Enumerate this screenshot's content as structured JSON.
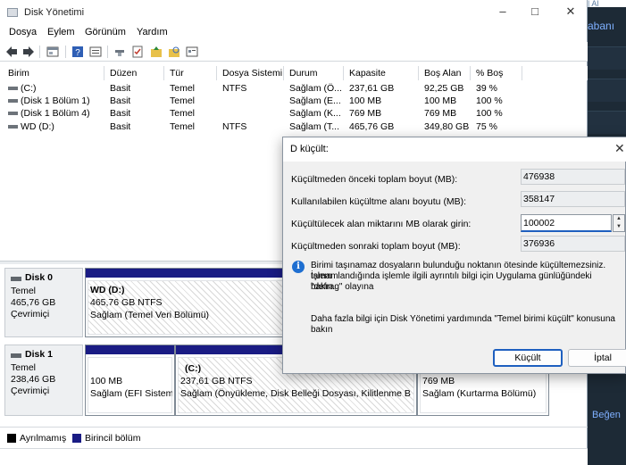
{
  "window": {
    "title": "Disk Yönetimi"
  },
  "background_app": {
    "top_text": "| Al",
    "link1": "abanı",
    "link2": "Beğen"
  },
  "menu": [
    "Dosya",
    "Eylem",
    "Görünüm",
    "Yardım"
  ],
  "volumes": {
    "headers": [
      "Birim",
      "Düzen",
      "Tür",
      "Dosya Sistemi",
      "Durum",
      "Kapasite",
      "Boş Alan",
      "% Boş"
    ],
    "rows": [
      [
        "(C:)",
        "Basit",
        "Temel",
        "NTFS",
        "Sağlam (Ö...",
        "237,61 GB",
        "92,25 GB",
        "39 %"
      ],
      [
        "(Disk 1 Bölüm 1)",
        "Basit",
        "Temel",
        "",
        "Sağlam (E...",
        "100 MB",
        "100 MB",
        "100 %"
      ],
      [
        "(Disk 1 Bölüm 4)",
        "Basit",
        "Temel",
        "",
        "Sağlam (K...",
        "769 MB",
        "769 MB",
        "100 %"
      ],
      [
        "WD (D:)",
        "Basit",
        "Temel",
        "NTFS",
        "Sağlam (T...",
        "465,76 GB",
        "349,80 GB",
        "75 %"
      ]
    ]
  },
  "disks": [
    {
      "name": "Disk 0",
      "type": "Temel",
      "size": "465,76 GB",
      "status": "Çevrimiçi",
      "partitions": [
        {
          "title": "WD  (D:)",
          "line2": "465,76 GB NTFS",
          "line3": "Sağlam (Temel Veri Bölümü)"
        }
      ]
    },
    {
      "name": "Disk 1",
      "type": "Temel",
      "size": "238,46 GB",
      "status": "Çevrimiçi",
      "partitions": [
        {
          "title": "",
          "line2": "100 MB",
          "line3": "Sağlam (EFI Sistem"
        },
        {
          "title": "(C:)",
          "line2": "237,61 GB NTFS",
          "line3": "Sağlam (Önyükleme, Disk Belleği Dosyası, Kilitlenme Bilç"
        },
        {
          "title": "",
          "line2": "769 MB",
          "line3": "Sağlam (Kurtarma Bölümü)"
        }
      ]
    }
  ],
  "legend": {
    "unallocated": "Ayrılmamış",
    "primary": "Birincil bölüm"
  },
  "colors": {
    "primary_bar": "#1a1c84",
    "unallocated": "#000000",
    "accent": "#1e5fbf"
  },
  "dialog": {
    "title": "D küçült:",
    "label_total_before": "Küçültmeden önceki toplam boyut (MB):",
    "value_total_before": "476938",
    "label_available": "Kullanılabilen küçültme alanı boyutu (MB):",
    "value_available": "358147",
    "label_amount": "Küçültülecek alan miktarını MB olarak girin:",
    "value_amount": "100002",
    "label_total_after": "Küçültmeden sonraki toplam boyut (MB):",
    "value_total_after": "376936",
    "info_line1": "Birimi taşınamaz dosyaların bulunduğu noktanın ötesinde küçültemezsiniz. İşlem",
    "info_line2": "tamamlandığında işlemle ilgili ayrıntılı bilgi için Uygulama günlüğündeki \"defrag\" olayına",
    "info_line3": "bakın.",
    "help_line1": "Daha fazla bilgi için Disk Yönetimi yardımında \"Temel birimi küçült\" konusuna",
    "help_line2": "bakın",
    "shrink_button": "Küçült",
    "cancel_button": "İptal"
  }
}
